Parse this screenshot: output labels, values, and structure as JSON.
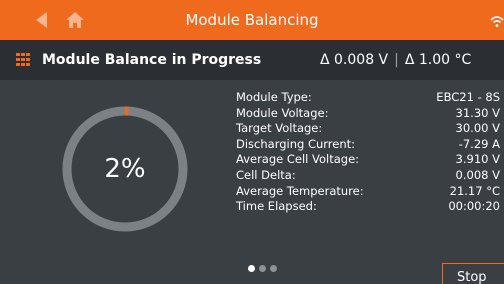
{
  "header": {
    "title": "Module Balancing"
  },
  "status": {
    "heading": "Module Balance in Progress",
    "delta_voltage": "Δ 0.008 V",
    "delta_temp": "Δ 1.00 °C",
    "separator": "|"
  },
  "gauge": {
    "label": "2%",
    "progress": 0.02,
    "color": "#f06a1e",
    "track_color": "#7c8186"
  },
  "info": {
    "rows": [
      {
        "key": "Module Type:",
        "value": "EBC21 - 8S"
      },
      {
        "key": "Module Voltage:",
        "value": "31.30 V"
      },
      {
        "key": "Target Voltage:",
        "value": "30.00 V"
      },
      {
        "key": "Discharging Current:",
        "value": "-7.29 A"
      },
      {
        "key": "Average Cell Voltage:",
        "value": "3.910 V"
      },
      {
        "key": "Cell Delta:",
        "value": "0.008 V"
      },
      {
        "key": "Average Temperature:",
        "value": "21.17 °C"
      },
      {
        "key": "Time Elapsed:",
        "value": "00:00:20"
      }
    ]
  },
  "pager": {
    "pages": 3,
    "active": 0
  },
  "actions": {
    "stop_label": "Stop"
  },
  "icons": {
    "back": "back-arrow-icon",
    "home": "home-icon",
    "wifi": "wifi-icon",
    "module": "battery-module-icon"
  },
  "colors": {
    "accent": "#f06a1e",
    "background": "#3a3f44",
    "bar": "#2b2f33"
  }
}
